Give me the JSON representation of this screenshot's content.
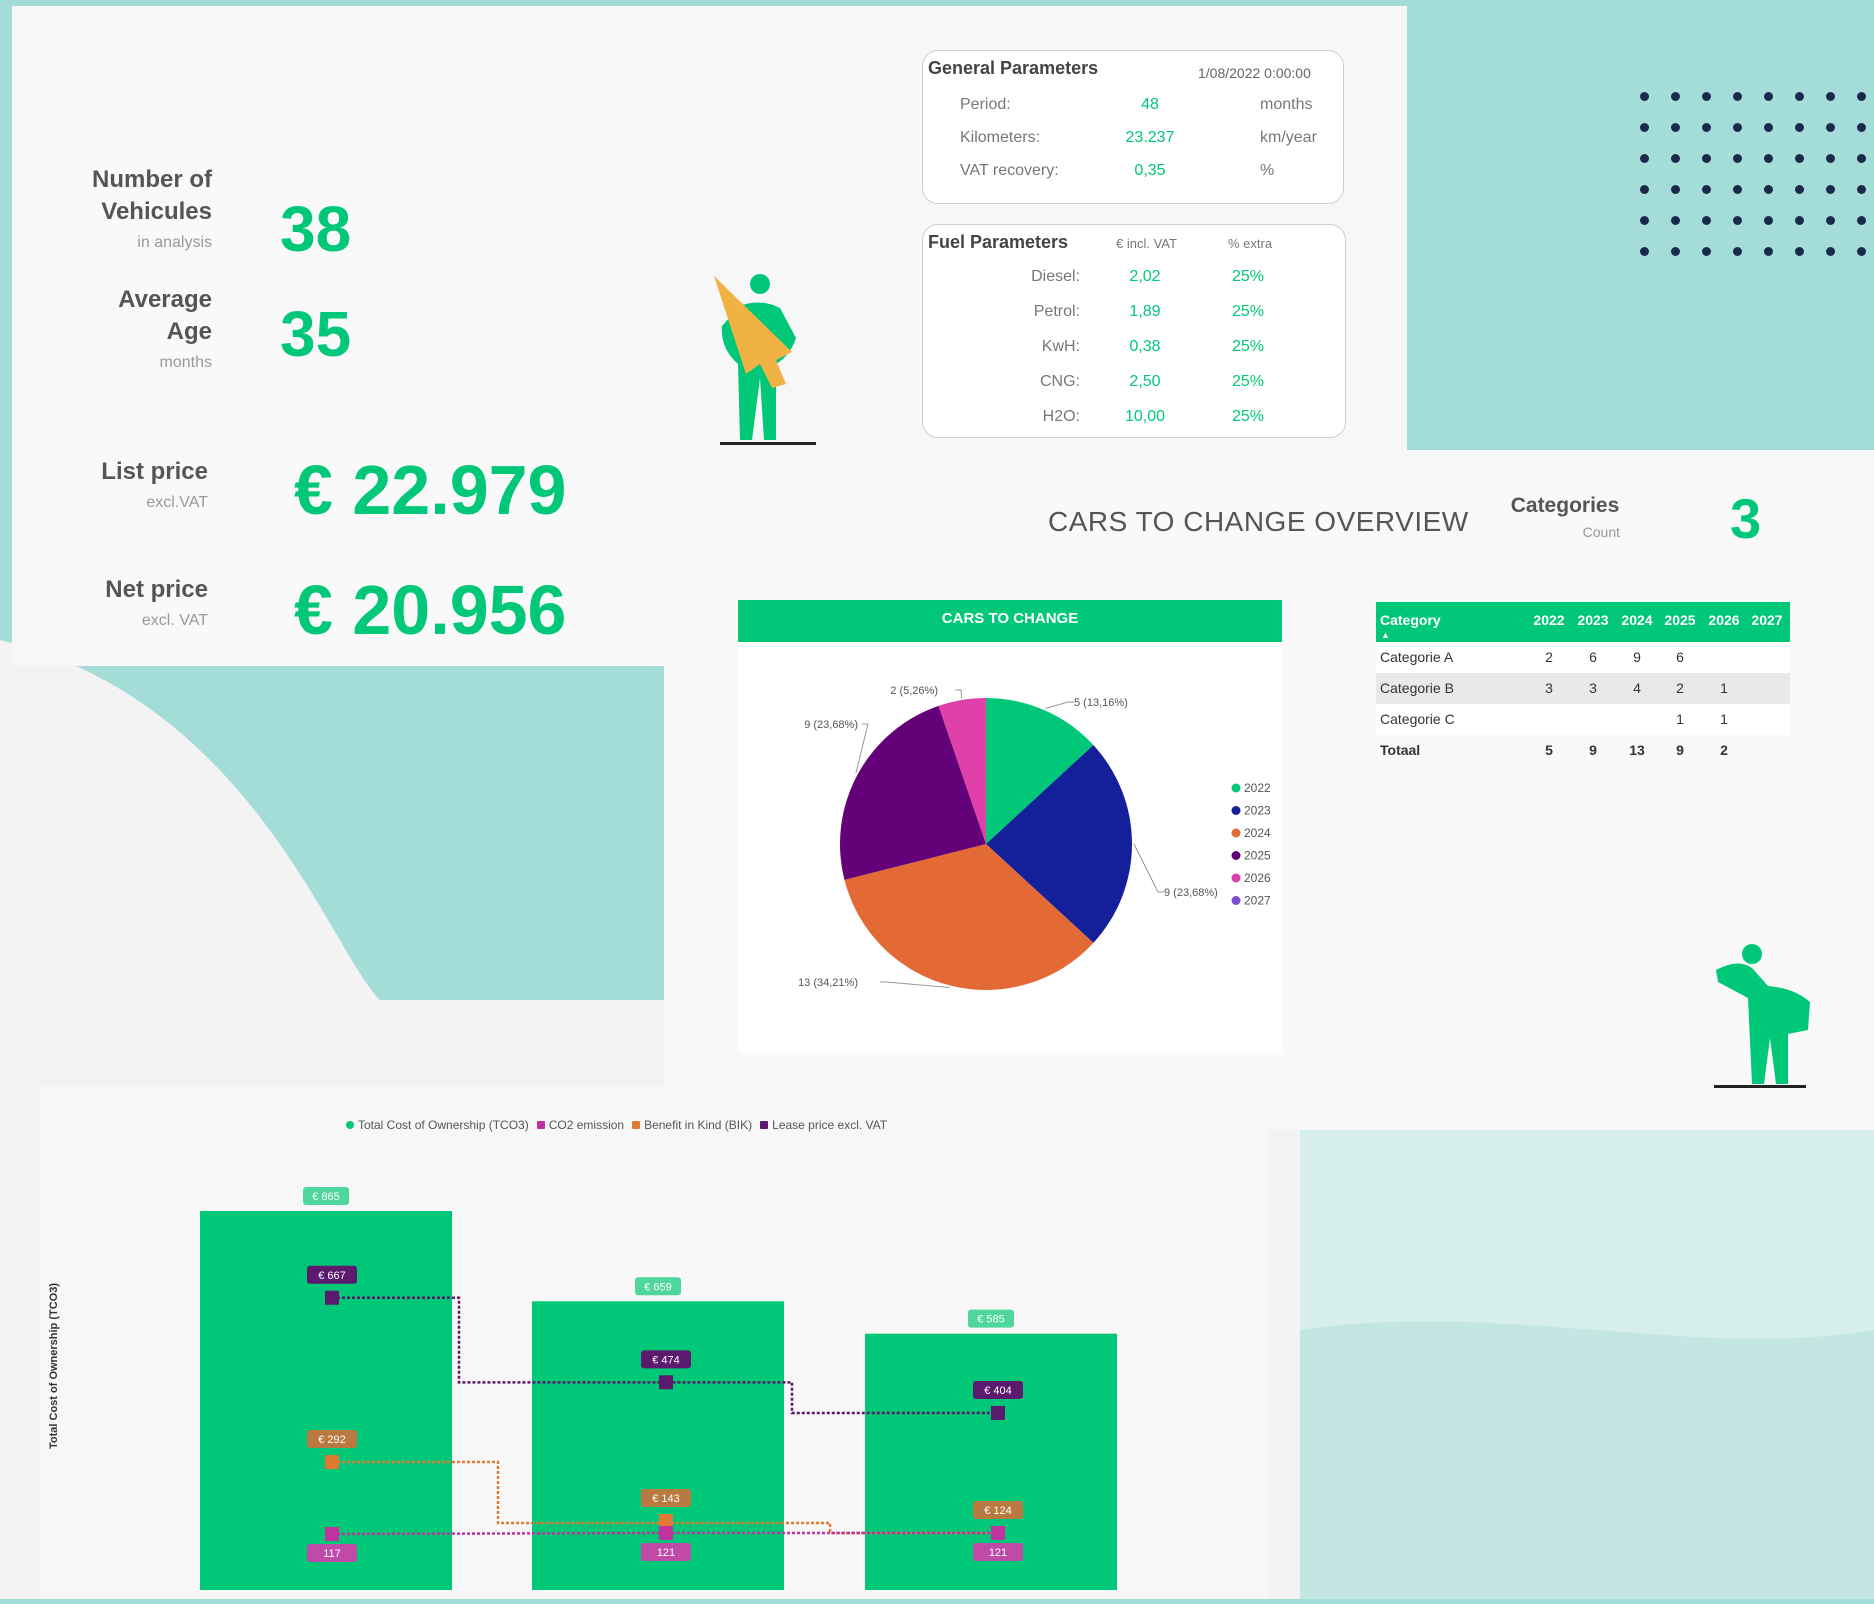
{
  "colors": {
    "green": "#00c878",
    "teal_bg": "#a4dcd8",
    "purple": "#5c1a6e",
    "orange": "#e07a32",
    "magenta": "#c0329e",
    "navy": "#14209a"
  },
  "kpi": {
    "vehicles_label_1": "Number of",
    "vehicles_label_2": "Vehicules",
    "vehicles_sub": "in analysis",
    "vehicles_value": "38",
    "age_label_1": "Average",
    "age_label_2": "Age",
    "age_sub": "months",
    "age_value": "35",
    "list_label": "List price",
    "list_sub": "excl.VAT",
    "list_value": "€ 22.979",
    "net_label": "Net price",
    "net_sub": "excl. VAT",
    "net_value": "€ 20.956"
  },
  "general": {
    "title": "General Parameters",
    "date": "1/08/2022 0:00:00",
    "rows": [
      {
        "label": "Period:",
        "value": "48",
        "unit": "months"
      },
      {
        "label": "Kilometers:",
        "value": "23.237",
        "unit": "km/year"
      },
      {
        "label": "VAT recovery:",
        "value": "0,35",
        "unit": "%"
      }
    ]
  },
  "fuel": {
    "title": "Fuel Parameters",
    "col1": "€ incl. VAT",
    "col2": "% extra",
    "rows": [
      {
        "label": "Diesel:",
        "price": "2,02",
        "extra": "25%"
      },
      {
        "label": "Petrol:",
        "price": "1,89",
        "extra": "25%"
      },
      {
        "label": "KwH:",
        "price": "0,38",
        "extra": "25%"
      },
      {
        "label": "CNG:",
        "price": "2,50",
        "extra": "25%"
      },
      {
        "label": "H2O:",
        "price": "10,00",
        "extra": "25%"
      }
    ]
  },
  "overview": {
    "title": "CARS TO CHANGE OVERVIEW",
    "categories_label": "Categories",
    "categories_sub": "Count",
    "categories_value": "3"
  },
  "table": {
    "headers": [
      "Category",
      "2022",
      "2023",
      "2024",
      "2025",
      "2026",
      "2027"
    ],
    "rows": [
      [
        "Categorie A",
        "2",
        "6",
        "9",
        "6",
        "",
        ""
      ],
      [
        "Categorie B",
        "3",
        "3",
        "4",
        "2",
        "1",
        ""
      ],
      [
        "Categorie C",
        "",
        "",
        "",
        "1",
        "1",
        ""
      ],
      [
        "Totaal",
        "5",
        "9",
        "13",
        "9",
        "2",
        ""
      ]
    ]
  },
  "chart_data": [
    {
      "type": "pie",
      "title": "CARS TO CHANGE",
      "legend_position": "right",
      "slices": [
        {
          "label": "2022",
          "value": 5,
          "text": "5 (13,16%)",
          "color": "#00c878"
        },
        {
          "label": "2023",
          "value": 9,
          "text": "9 (23,68%)",
          "color": "#14209a"
        },
        {
          "label": "2024",
          "value": 13,
          "text": "13 (34,21%)",
          "color": "#e46a35"
        },
        {
          "label": "2025",
          "value": 9,
          "text": "9 (23,68%)",
          "color": "#640078"
        },
        {
          "label": "2026",
          "value": 2,
          "text": "2 (5,26%)",
          "color": "#e040aa"
        },
        {
          "label": "2027",
          "value": 0,
          "text": "",
          "color": "#7b4fd6"
        }
      ]
    },
    {
      "type": "bar",
      "ylabel": "Total Cost of Ownership (TCO3)",
      "legend": [
        "Total Cost of Ownership (TCO3)",
        "CO2 emission",
        "Benefit in Kind (BIK)",
        "Lease price excl. VAT"
      ],
      "categories": [
        "",
        "",
        ""
      ],
      "series": [
        {
          "name": "Total Cost of Ownership (TCO3)",
          "type": "bar",
          "values": [
            865,
            659,
            585
          ],
          "labels": [
            "€ 865",
            "€ 659",
            "€ 585"
          ]
        },
        {
          "name": "Lease price excl. VAT",
          "type": "step-line",
          "values": [
            667,
            474,
            404
          ],
          "labels": [
            "€ 667",
            "€ 474",
            "€ 404"
          ]
        },
        {
          "name": "Benefit in Kind (BIK)",
          "type": "step-line",
          "values": [
            292,
            143,
            124
          ],
          "labels": [
            "€ 292",
            "€ 143",
            "€ 124"
          ]
        },
        {
          "name": "CO2 emission",
          "type": "step-line",
          "values": [
            117,
            121,
            121
          ],
          "labels": [
            "117",
            "121",
            "121"
          ]
        }
      ]
    }
  ]
}
